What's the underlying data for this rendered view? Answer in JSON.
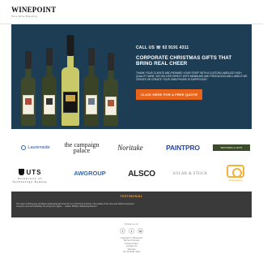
{
  "header": {
    "logo_main": "WINEPOINT",
    "logo_sub": "Pure Wine Branding"
  },
  "hero": {
    "call": "CALL US ☏ 02 9191 4311",
    "title": "CORPORATE CHRISTMAS GIFTS THAT BRING REAL CHEER",
    "description": "THANK YOUR CLIENTS AND REWARD YOUR STAFF WITH A CUSTOM LABELLED HIGH QUALITY WINE. WE DELIVER DIRECT WITH MINIMUMS AND PRODUCING AND LABELS WE CREATE OR CREATE YOUR OWN PHONE IS SUPER EASY.",
    "cta": "CLICK HERE FOR A FREE QUOTE",
    "bottles": [
      {
        "type": "sparkling",
        "glass": "#3f4a2c",
        "foil": "#2b2b2b"
      },
      {
        "type": "sparkling",
        "glass": "#394326",
        "foil": "#2b2b2b"
      },
      {
        "type": "white",
        "glass": "#c9c96a",
        "foil": "#1c1c1c"
      },
      {
        "type": "sparkling",
        "glass": "#3a4326",
        "foil": "#2b2b2b"
      },
      {
        "type": "sparkling",
        "glass": "#3d4729",
        "foil": "#2b2b2b"
      }
    ]
  },
  "clients": {
    "row1": {
      "laurent": "Laurenside",
      "campaign": "the campaign palace",
      "noritake": "Noritake",
      "paintpro": "PAINTPRO",
      "wesley": "WESTERN & ARTS"
    },
    "row2": {
      "uts": "UTS",
      "uts_sub": "University of Technology Sydney",
      "aw": "AWGROUP",
      "alsco": "ALSCO",
      "solar": "SOLAR & STOCK",
      "photo": "photography"
    }
  },
  "testimonial": {
    "title": "TESTIMONIAL",
    "text": "The team at Winepoint provided outstanding gift wines for our Christmas function. The quality of the wine and labels impressed everyone and we'll definitely be using them again. — Alison Phillips, Marketing Director"
  },
  "footer": {
    "follow": "Follow us on",
    "socials": [
      "f",
      "t",
      "in"
    ],
    "links": [
      "Copyright © Winepoint",
      "Terms of Service",
      "Privacy Policy",
      "Contact Us",
      "Sitemap",
      "Tel: 02 9191 4311"
    ]
  },
  "colors": {
    "hero_bg": "#1d3d55",
    "cta": "#e8641a",
    "testimonial_bg": "#3a3a3a",
    "testimonial_title": "#f2a33a"
  }
}
